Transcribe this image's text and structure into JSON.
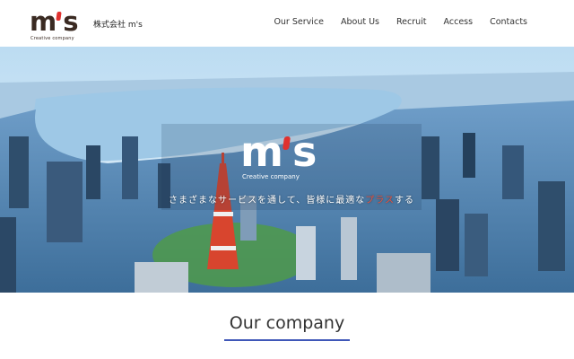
{
  "header": {
    "logo_text": "m's",
    "logo_sub": "Creative company",
    "company_name": "株式会社 m's"
  },
  "nav": [
    {
      "label": "Our Service"
    },
    {
      "label": "About Us"
    },
    {
      "label": "Recruit"
    },
    {
      "label": "Access"
    },
    {
      "label": "Contacts"
    }
  ],
  "hero": {
    "logo_text": "m's",
    "logo_sub": "Creative company",
    "tagline_before": "さまざまなサービスを通して、皆様に最適な",
    "tagline_accent": "プラス",
    "tagline_after": "する"
  },
  "section": {
    "title": "Our company"
  },
  "colors": {
    "accent": "#e0322f",
    "underline": "#3f57b8",
    "logo_brown": "#3a2a22",
    "sky": "#cfe6f6",
    "water": "#9ec8e6"
  },
  "icons": {
    "hero_image": "city-aerial-photo"
  }
}
